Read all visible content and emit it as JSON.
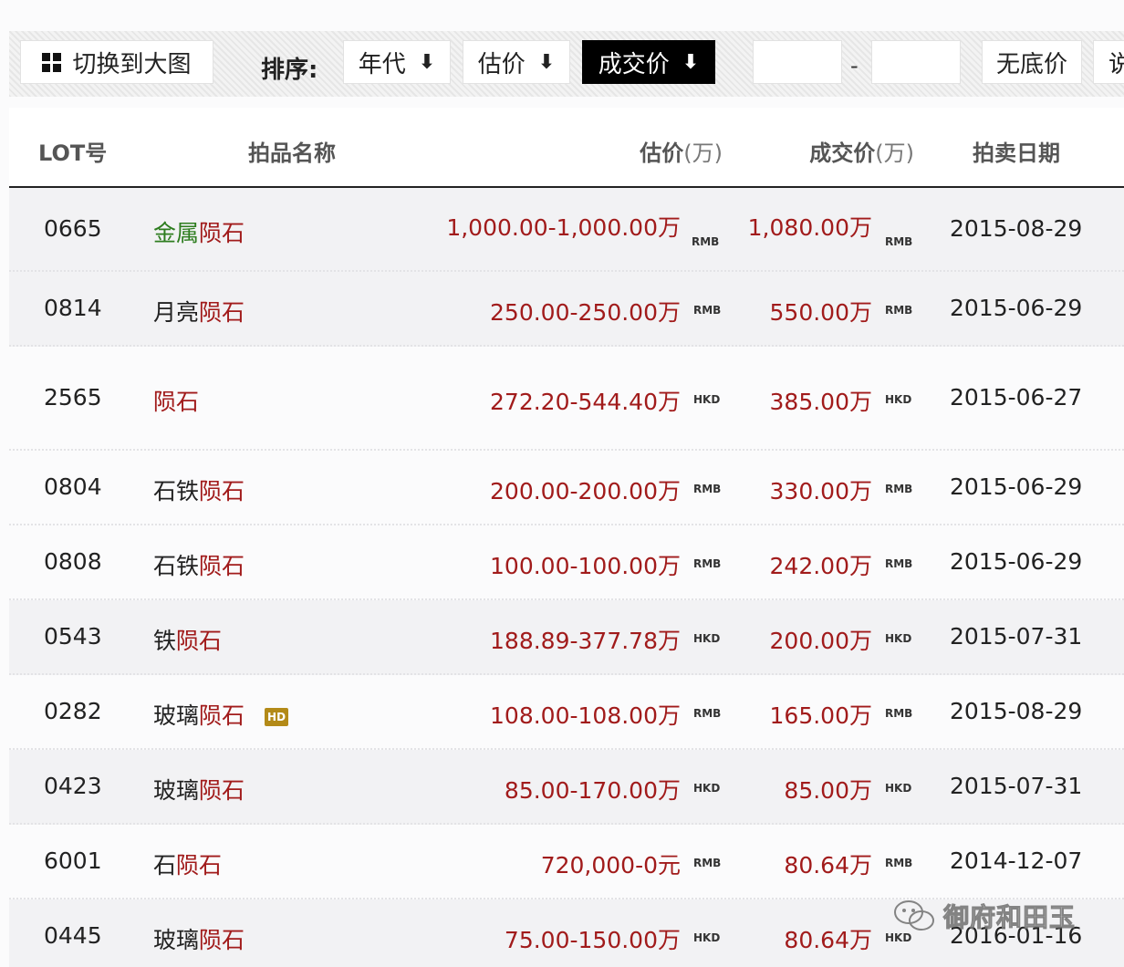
{
  "toolbar": {
    "toggle_label": "切换到大图",
    "sort_label": "排序:",
    "sort_buttons": [
      {
        "label": "年代",
        "arrow": "⬇"
      },
      {
        "label": "估价",
        "arrow": "⬇"
      },
      {
        "label": "成交价",
        "arrow": "⬇"
      }
    ],
    "price_min": "",
    "price_max": "",
    "dash": "-",
    "no_reserve_label": "无底价",
    "cut_off_glyph": "说"
  },
  "table": {
    "headers": {
      "lot": "LOT号",
      "name": "拍品名称",
      "estimate": "估价",
      "estimate_unit": "(万)",
      "deal": "成交价",
      "deal_unit": "(万)",
      "date": "拍卖日期"
    },
    "rows": [
      {
        "lot": "0665",
        "name_pre": "金属",
        "name_main": "陨石",
        "estimate": "1,000.00-1,000.00万",
        "estimate_cur": "RMB",
        "deal": "1,080.00万",
        "deal_cur": "RMB",
        "date": "2015-08-29"
      },
      {
        "lot": "0814",
        "name_pre": "月亮",
        "name_main": "陨石",
        "estimate": "250.00-250.00万",
        "estimate_cur": "RMB",
        "deal": "550.00万",
        "deal_cur": "RMB",
        "date": "2015-06-29"
      },
      {
        "lot": "2565",
        "name_pre": "",
        "name_main": "陨石",
        "estimate": "272.20-544.40万",
        "estimate_cur": "HKD",
        "deal": "385.00万",
        "deal_cur": "HKD",
        "date": "2015-06-27"
      },
      {
        "lot": "0804",
        "name_pre": "石铁",
        "name_main": "陨石",
        "estimate": "200.00-200.00万",
        "estimate_cur": "RMB",
        "deal": "330.00万",
        "deal_cur": "RMB",
        "date": "2015-06-29"
      },
      {
        "lot": "0808",
        "name_pre": "石铁",
        "name_main": "陨石",
        "estimate": "100.00-100.00万",
        "estimate_cur": "RMB",
        "deal": "242.00万",
        "deal_cur": "RMB",
        "date": "2015-06-29"
      },
      {
        "lot": "0543",
        "name_pre": "铁",
        "name_main": "陨石",
        "estimate": "188.89-377.78万",
        "estimate_cur": "HKD",
        "deal": "200.00万",
        "deal_cur": "HKD",
        "date": "2015-07-31"
      },
      {
        "lot": "0282",
        "name_pre": "玻璃",
        "name_main": "陨石",
        "badge": "HD",
        "estimate": "108.00-108.00万",
        "estimate_cur": "RMB",
        "deal": "165.00万",
        "deal_cur": "RMB",
        "date": "2015-08-29"
      },
      {
        "lot": "0423",
        "name_pre": "玻璃",
        "name_main": "陨石",
        "estimate": "85.00-170.00万",
        "estimate_cur": "HKD",
        "deal": "85.00万",
        "deal_cur": "HKD",
        "date": "2015-07-31"
      },
      {
        "lot": "6001",
        "name_pre": "石",
        "name_main": "陨石",
        "estimate": "720,000-0元",
        "estimate_cur": "RMB",
        "deal": "80.64万",
        "deal_cur": "RMB",
        "date": "2014-12-07"
      },
      {
        "lot": "0445",
        "name_pre": "玻璃",
        "name_main": "陨石",
        "estimate": "75.00-150.00万",
        "estimate_cur": "HKD",
        "deal": "80.64万",
        "deal_cur": "HKD",
        "date": "2016-01-16"
      }
    ]
  },
  "watermark": {
    "text": "御府和田玉",
    "icon": "wechat-icon"
  },
  "colors": {
    "price_red": "#a11b1b",
    "name_green": "#2e7d1f",
    "active_button": "#000000",
    "hd_badge": "#b38a18"
  }
}
